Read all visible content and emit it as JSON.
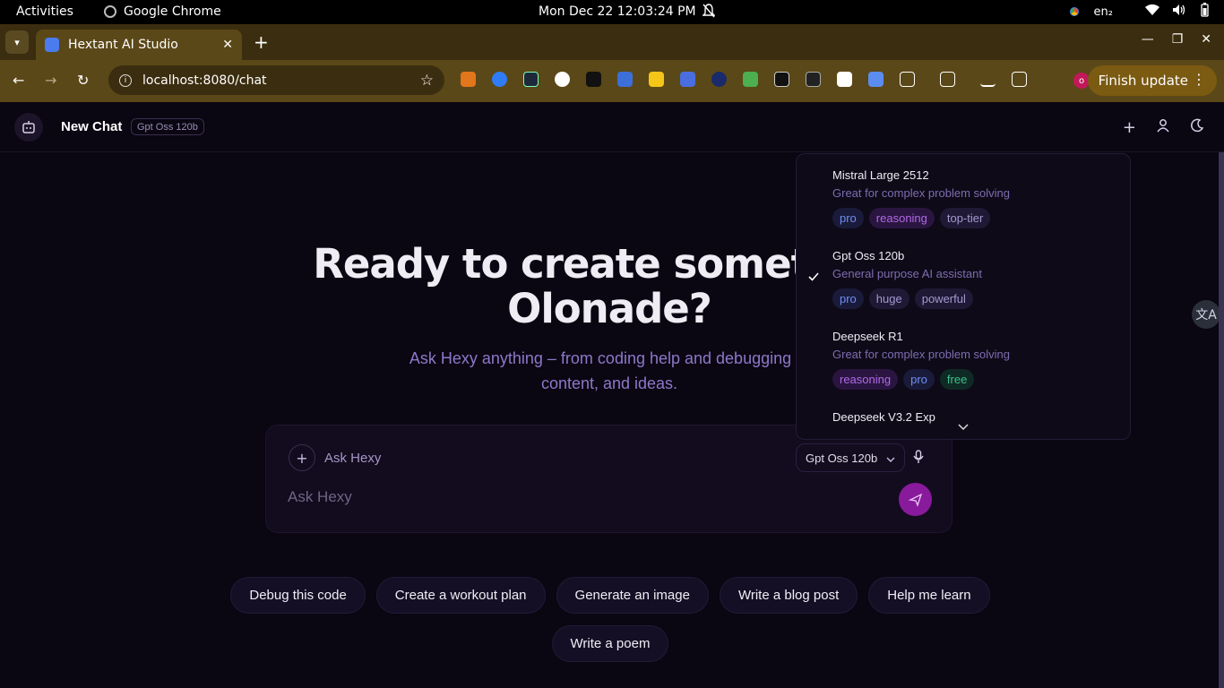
{
  "os": {
    "activities": "Activities",
    "app_name": "Google Chrome",
    "clock": "Mon Dec 22  12:03:24 PM",
    "lang": "en₂"
  },
  "browser": {
    "tab_title": "Hextant AI Studio",
    "url": "localhost:8080/chat",
    "finish_update": "Finish update",
    "profile_initial": "o"
  },
  "header": {
    "title": "New Chat",
    "model_badge": "Gpt Oss 120b"
  },
  "hero": {
    "title_line1": "Ready to create something",
    "title_line2": "Olonade?",
    "subtitle_line1": "Ask Hexy anything – from coding help and debugging to",
    "subtitle_line2": "content, and ideas."
  },
  "composer": {
    "ask_label": "Ask Hexy",
    "selected_model": "Gpt Oss 120b",
    "placeholder": "Ask Hexy"
  },
  "suggestions": [
    "Debug this code",
    "Create a workout plan",
    "Generate an image",
    "Write a blog post",
    "Help me learn",
    "Write a poem"
  ],
  "models": [
    {
      "name": "Mistral Large 2512",
      "desc": "Great for complex problem solving",
      "tags": [
        "pro",
        "reasoning",
        "top-tier"
      ]
    },
    {
      "name": "Gpt Oss 120b",
      "desc": "General purpose AI assistant",
      "tags": [
        "pro",
        "huge",
        "powerful"
      ],
      "selected": true
    },
    {
      "name": "Deepseek R1",
      "desc": "Great for complex problem solving",
      "tags": [
        "reasoning",
        "pro",
        "free"
      ]
    },
    {
      "name": "Deepseek V3.2 Exp"
    }
  ]
}
